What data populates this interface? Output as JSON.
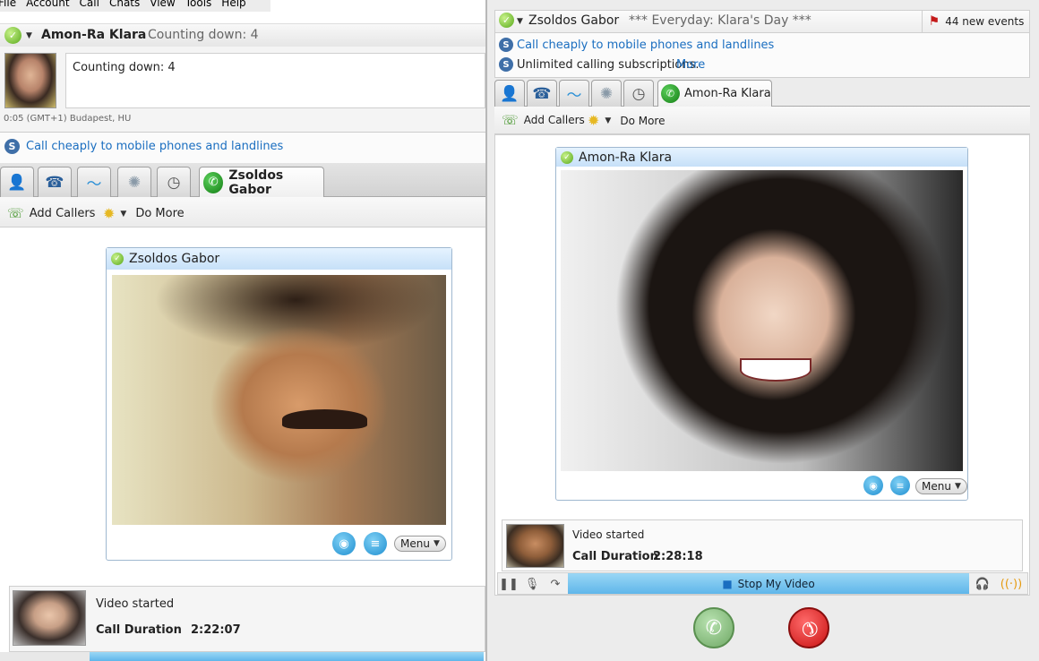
{
  "left": {
    "menu": [
      "File",
      "Account",
      "Call",
      "Chats",
      "View",
      "Tools",
      "Help"
    ],
    "header": {
      "name": "Amon-Ra Klara",
      "mood": "Counting down: 4"
    },
    "mood_text": "Counting down: 4",
    "location": "0:05 (GMT+1) Budapest, HU",
    "promo": "Call cheaply to mobile phones and landlines",
    "call_tab_label": "Zsoldos Gabor",
    "toolbar": {
      "add_callers": "Add Callers",
      "do_more": "Do More"
    },
    "video": {
      "title": "Zsoldos Gabor",
      "menu": "Menu"
    },
    "status": {
      "video_started": "Video started",
      "duration_label": "Call Duration",
      "duration": "2:22:07"
    }
  },
  "right": {
    "header": {
      "name": "Zsoldos Gabor",
      "mood": "*** Everyday: Klara's Day ***"
    },
    "events": "44 new events",
    "promo1": "Call cheaply to mobile phones and landlines",
    "promo2_text": "Unlimited calling subscriptions.",
    "promo2_link": "More",
    "call_tab_label": "Amon-Ra Klara",
    "toolbar": {
      "add_callers": "Add Callers",
      "do_more": "Do More"
    },
    "video": {
      "title": "Amon-Ra Klara",
      "menu": "Menu"
    },
    "status": {
      "video_started": "Video started",
      "duration_label": "Call Duration",
      "duration": "2:28:18"
    },
    "stop_video": "Stop My Video"
  },
  "colors": {
    "accent_blue": "#1a6ec0",
    "video_title_bg": "#c6e0f8",
    "hangup_red": "#c91212",
    "answer_green": "#6fa865"
  }
}
